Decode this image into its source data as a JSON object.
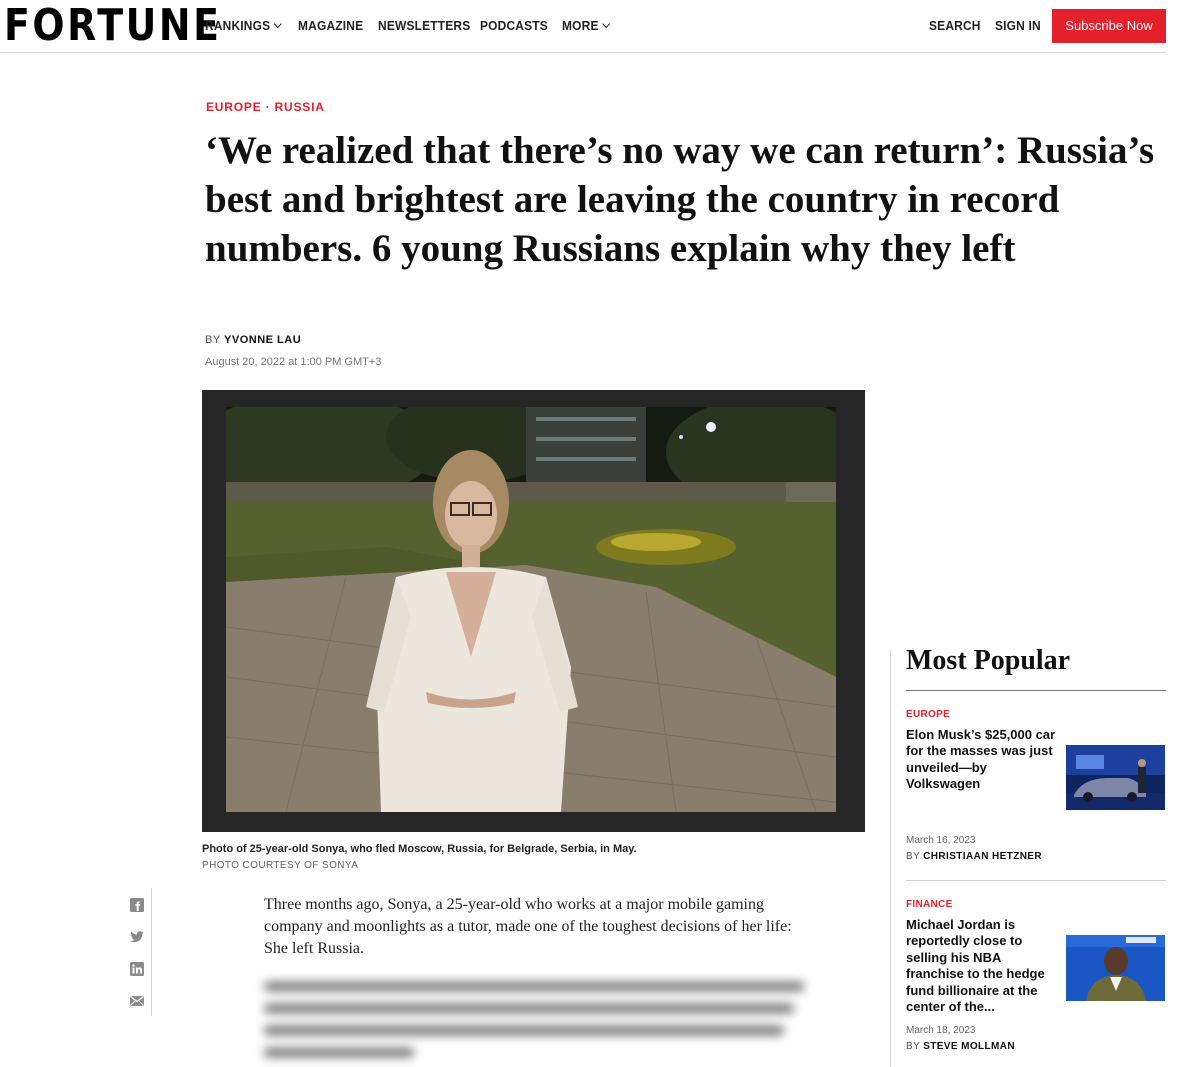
{
  "header": {
    "logo": "FORTUNE",
    "nav": [
      {
        "label": "RANKINGS",
        "has_dropdown": true
      },
      {
        "label": "MAGAZINE",
        "has_dropdown": false
      },
      {
        "label": "NEWSLETTERS",
        "has_dropdown": false
      },
      {
        "label": "PODCASTS",
        "has_dropdown": false
      },
      {
        "label": "MORE",
        "has_dropdown": true
      }
    ],
    "search_label": "SEARCH",
    "signin_label": "SIGN IN",
    "subscribe_label": "Subscribe Now",
    "accent_color": "#e4212b"
  },
  "article": {
    "kicker": "EUROPE · RUSSIA",
    "headline": "‘We realized that there’s no way we can return’: Russia’s best and brightest are leaving the country in record numbers. 6 young Russians explain why they left",
    "byline_prefix": "BY",
    "author": "YVONNE LAU",
    "date": "August 20, 2022 at 1:00 PM GMT+3",
    "photo_caption": "Photo of 25-year-old Sonya, who fled Moscow, Russia, for Belgrade, Serbia, in May.",
    "photo_credit": "PHOTO COURTESY OF SONYA",
    "lede": "Three months ago, Sonya, a 25-year-old who works at a major mobile gaming company and moonlights as a tutor, made one of the toughest decisions of her life: She left Russia.",
    "share_icons": [
      "facebook-icon",
      "twitter-icon",
      "linkedin-icon",
      "email-icon"
    ]
  },
  "most_popular": {
    "title": "Most Popular",
    "items": [
      {
        "category": "EUROPE",
        "headline": "Elon Musk’s $25,000 car for the masses was just unveiled—by Volkswagen",
        "date": "March 16, 2023",
        "byline_prefix": "BY",
        "author": "CHRISTIAAN HETZNER"
      },
      {
        "category": "FINANCE",
        "headline": "Michael Jordan is reportedly close to selling his NBA franchise to the hedge fund billionaire at the center of the...",
        "date": "March 18, 2023",
        "byline_prefix": "BY",
        "author": "STEVE MOLLMAN"
      }
    ]
  }
}
